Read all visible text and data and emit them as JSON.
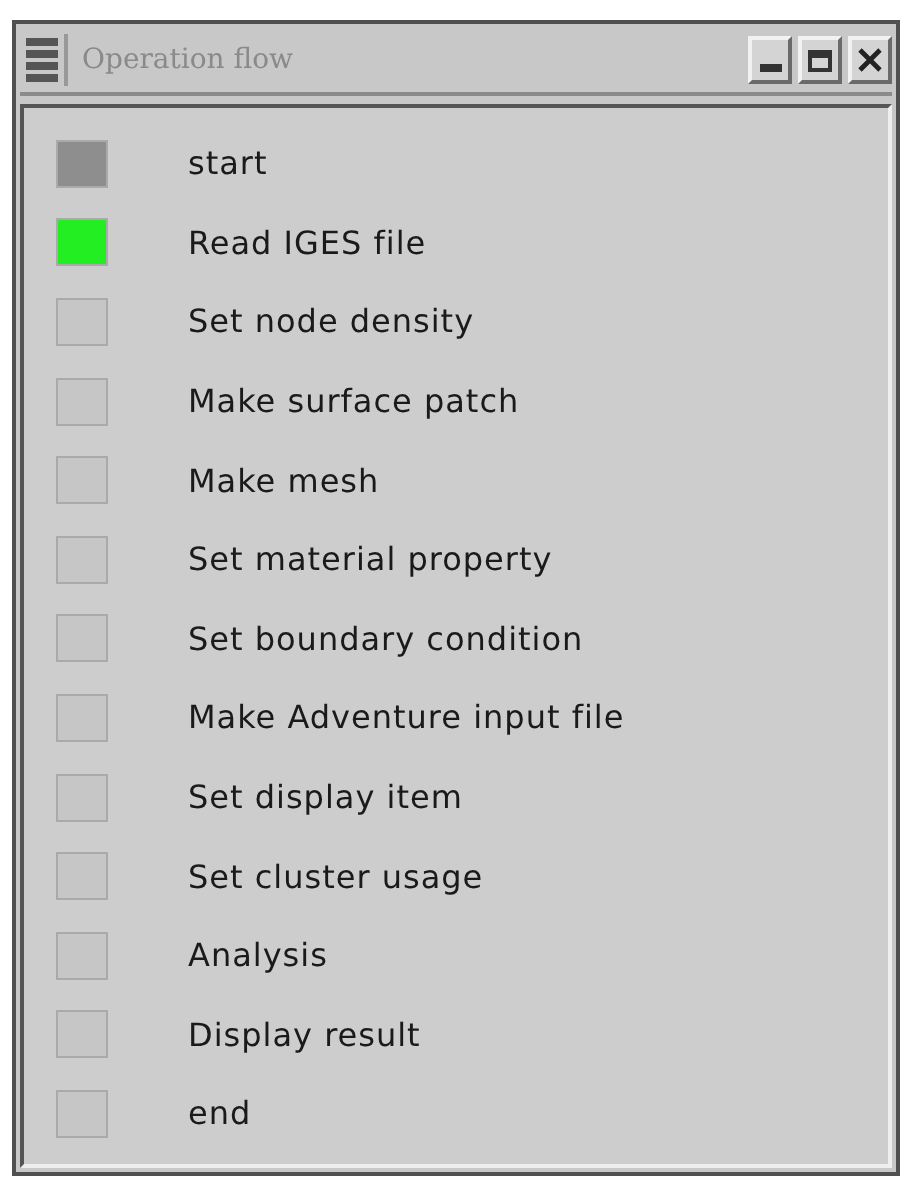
{
  "window": {
    "title": "Operation flow"
  },
  "steps": [
    {
      "label": "start",
      "color": "#8e8e8e"
    },
    {
      "label": "Read IGES file",
      "color": "#22ee22"
    },
    {
      "label": "Set node density",
      "color": "#c6c6c6"
    },
    {
      "label": "Make surface patch",
      "color": "#c6c6c6"
    },
    {
      "label": "Make mesh",
      "color": "#c6c6c6"
    },
    {
      "label": "Set material property",
      "color": "#c6c6c6"
    },
    {
      "label": "Set boundary condition",
      "color": "#c6c6c6"
    },
    {
      "label": "Make Adventure input file",
      "color": "#c6c6c6"
    },
    {
      "label": "Set display item",
      "color": "#c6c6c6"
    },
    {
      "label": "Set cluster usage",
      "color": "#c6c6c6"
    },
    {
      "label": "Analysis",
      "color": "#c6c6c6"
    },
    {
      "label": "Display result",
      "color": "#c6c6c6"
    },
    {
      "label": "end",
      "color": "#c6c6c6"
    }
  ]
}
